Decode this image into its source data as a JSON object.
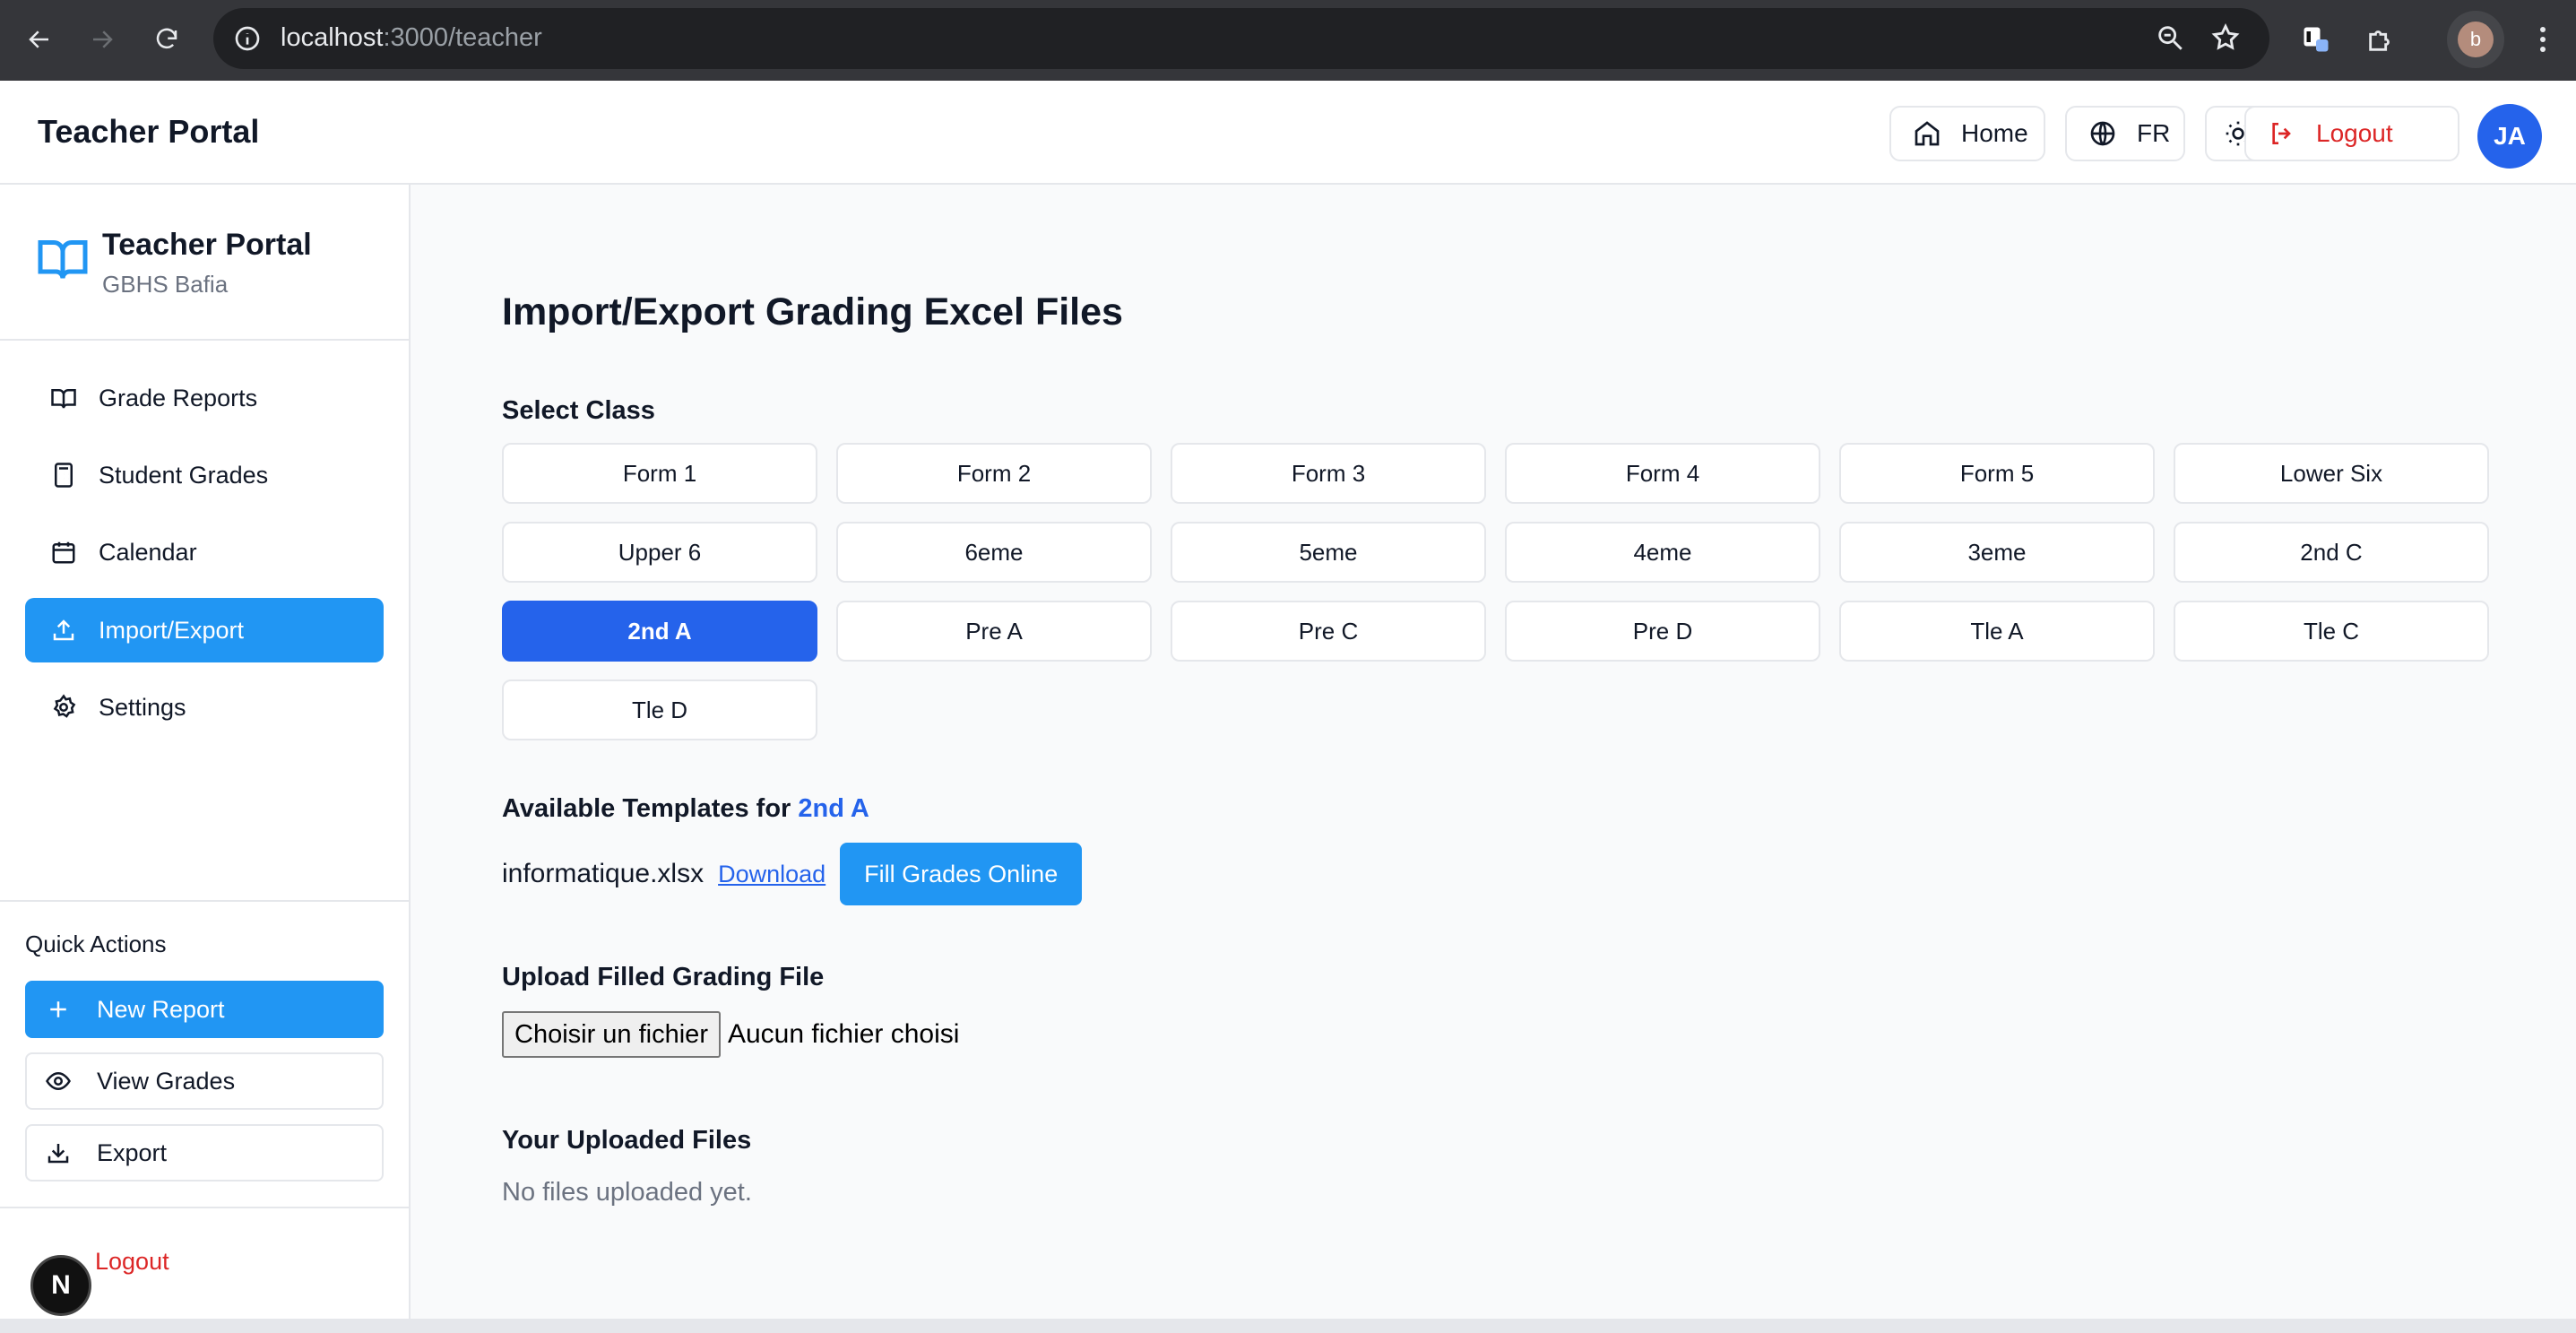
{
  "browser": {
    "url_host": "localhost",
    "url_rest": ":3000/teacher",
    "profile_initial": "b"
  },
  "header": {
    "title": "Teacher Portal",
    "home_label": "Home",
    "lang_label": "FR",
    "logout_label": "Logout",
    "avatar_initials": "JA"
  },
  "sidebar": {
    "brand_name": "Teacher Portal",
    "school": "GBHS Bafia",
    "items": [
      {
        "label": "Grade Reports",
        "icon": "book-open-icon",
        "active": false
      },
      {
        "label": "Student Grades",
        "icon": "calculator-icon",
        "active": false
      },
      {
        "label": "Calendar",
        "icon": "calendar-icon",
        "active": false
      },
      {
        "label": "Import/Export",
        "icon": "upload-icon",
        "active": true
      },
      {
        "label": "Settings",
        "icon": "gear-icon",
        "active": false
      }
    ],
    "quick_actions_title": "Quick Actions",
    "quick_actions": [
      {
        "label": "New Report",
        "icon": "plus-icon",
        "primary": true
      },
      {
        "label": "View Grades",
        "icon": "eye-icon",
        "primary": false
      },
      {
        "label": "Export",
        "icon": "download-icon",
        "primary": false
      }
    ],
    "logout_label": "Logout",
    "dev_badge": "N"
  },
  "main": {
    "page_title": "Import/Export Grading Excel Files",
    "select_class_label": "Select Class",
    "classes": [
      "Form 1",
      "Form 2",
      "Form 3",
      "Form 4",
      "Form 5",
      "Lower Six",
      "Upper 6",
      "6eme",
      "5eme",
      "4eme",
      "3eme",
      "2nd C",
      "2nd A",
      "Pre A",
      "Pre C",
      "Pre D",
      "Tle A",
      "Tle C",
      "Tle D"
    ],
    "selected_class": "2nd A",
    "templates_label": "Available Templates for",
    "templates_class": "2nd A",
    "template_file": "informatique.xlsx",
    "download_label": "Download",
    "fill_online_label": "Fill Grades Online",
    "upload_label": "Upload Filled Grading File",
    "choose_file_label": "Choisir un fichier",
    "no_file_label": "Aucun fichier choisi",
    "uploaded_files_label": "Your Uploaded Files",
    "no_files_text": "No files uploaded yet."
  },
  "colors": {
    "primary": "#2196f3",
    "selected": "#2563eb",
    "danger": "#dc2626"
  }
}
